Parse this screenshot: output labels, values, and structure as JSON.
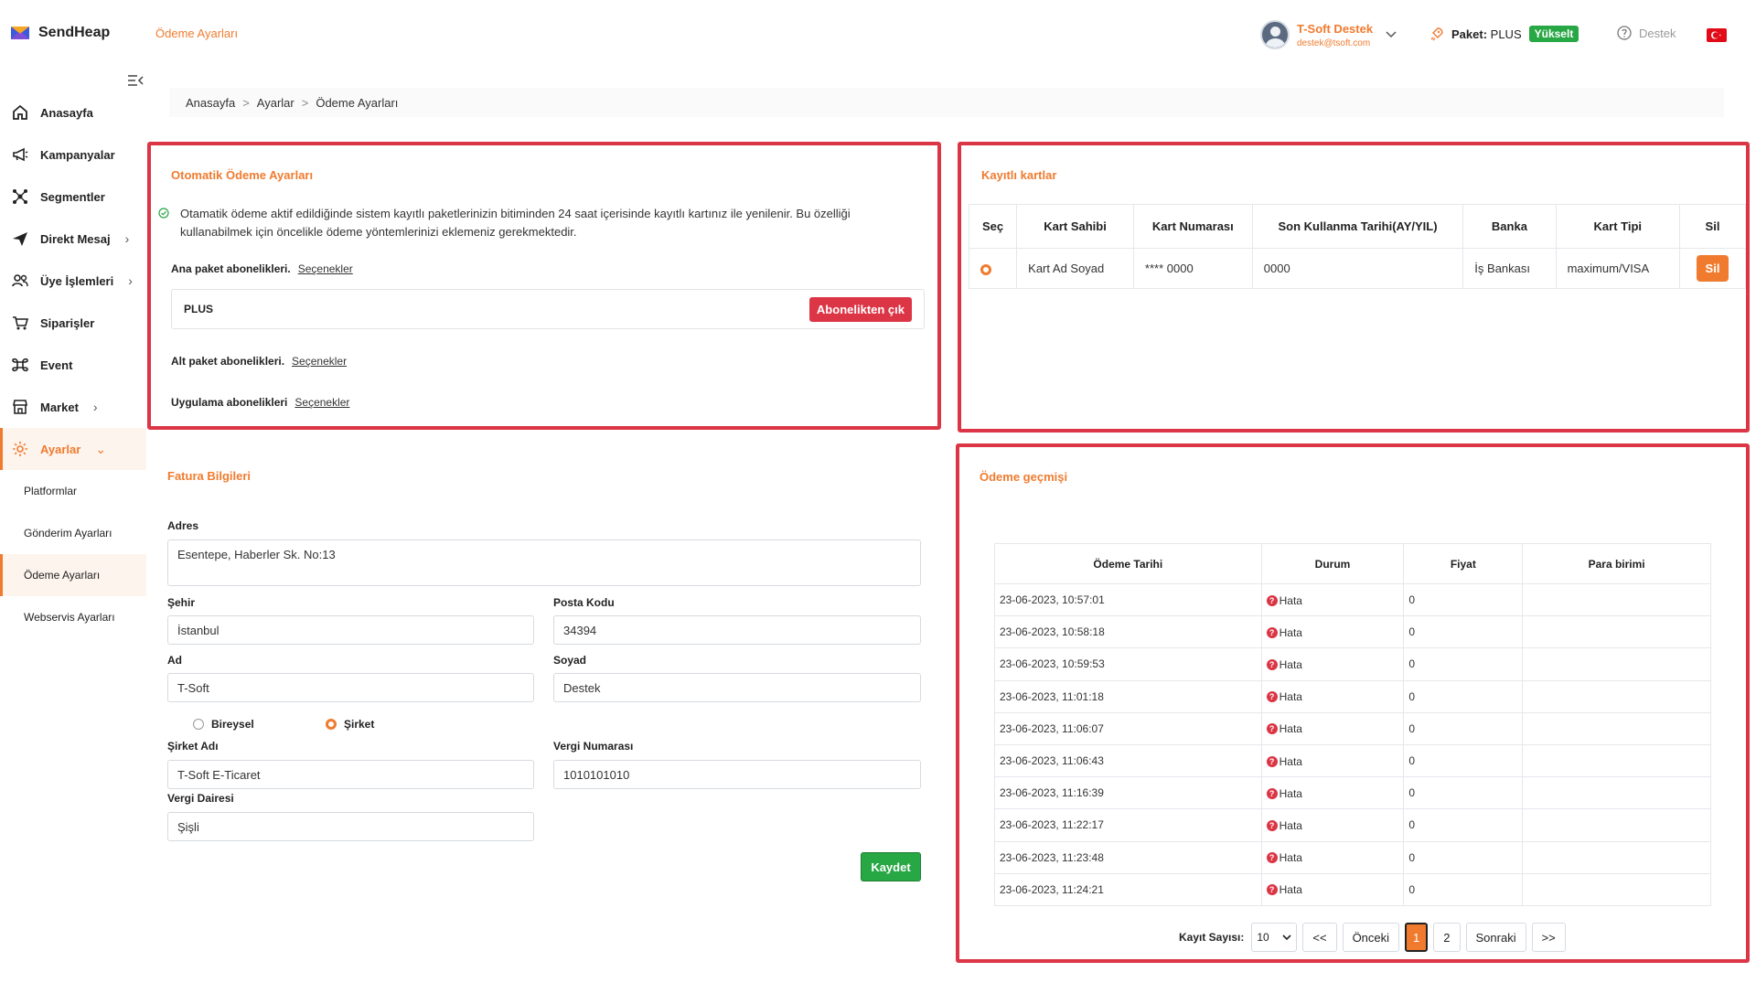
{
  "app": {
    "name": "SendHeap",
    "page_title": "Ödeme Ayarları"
  },
  "header": {
    "user_name": "T-Soft Destek",
    "user_email": "destek@tsoft.com",
    "package_label": "Paket:",
    "package_value": "PLUS",
    "upgrade_label": "Yükselt",
    "support_label": "Destek"
  },
  "sidebar": {
    "items": [
      {
        "label": "Anasayfa"
      },
      {
        "label": "Kampanyalar"
      },
      {
        "label": "Segmentler"
      },
      {
        "label": "Direkt Mesaj"
      },
      {
        "label": "Üye İşlemleri"
      },
      {
        "label": "Siparişler"
      },
      {
        "label": "Event"
      },
      {
        "label": "Market"
      },
      {
        "label": "Ayarlar"
      }
    ],
    "sub_items": [
      {
        "label": "Platformlar"
      },
      {
        "label": "Gönderim Ayarları"
      },
      {
        "label": "Ödeme Ayarları"
      },
      {
        "label": "Webservis Ayarları"
      }
    ]
  },
  "breadcrumb": {
    "home": "Anasayfa",
    "settings": "Ayarlar",
    "current": "Ödeme Ayarları",
    "sep": ">"
  },
  "auto_payment": {
    "title": "Otomatik Ödeme Ayarları",
    "info": "Otamatik ödeme aktif edildiğinde sistem kayıtlı paketlerinizin bitiminden 24 saat içerisinde kayıtlı kartınız ile yenilenir. Bu özelliği kullanabilmek için öncelikle ödeme yöntemlerinizi eklemeniz gerekmektedir.",
    "main_label": "Ana paket abonelikleri.",
    "sub_label": "Alt paket abonelikleri.",
    "app_label": "Uygulama abonelikleri",
    "options_link": "Seçenekler",
    "plan": "PLUS",
    "unsubscribe": "Abonelikten çık"
  },
  "saved_cards": {
    "title": "Kayıtlı kartlar",
    "columns": [
      "Seç",
      "Kart Sahibi",
      "Kart Numarası",
      "Son Kullanma Tarihi(AY/YIL)",
      "Banka",
      "Kart Tipi",
      "Sil"
    ],
    "row": {
      "holder": "Kart Ad Soyad",
      "number": "**** 0000",
      "expiry": "0000",
      "bank": "İş Bankası",
      "type": "maximum/VISA",
      "delete": "Sil"
    }
  },
  "invoice": {
    "title": "Fatura Bilgileri",
    "address_label": "Adres",
    "address": "Esentepe, Haberler Sk. No:13",
    "city_label": "Şehir",
    "city": "İstanbul",
    "postal_label": "Posta Kodu",
    "postal": "34394",
    "name_label": "Ad",
    "name": "T-Soft",
    "surname_label": "Soyad",
    "surname": "Destek",
    "individual": "Bireysel",
    "company": "Şirket",
    "company_name_label": "Şirket Adı",
    "company_name": "T-Soft E-Ticaret",
    "tax_no_label": "Vergi Numarası",
    "tax_no": "1010101010",
    "tax_office_label": "Vergi Dairesi",
    "tax_office": "Şişli",
    "save": "Kaydet"
  },
  "history": {
    "title": "Ödeme geçmişi",
    "columns": [
      "Ödeme Tarihi",
      "Durum",
      "Fiyat",
      "Para birimi"
    ],
    "status": "Hata",
    "rows": [
      {
        "date": "23-06-2023, 10:57:01",
        "price": "0"
      },
      {
        "date": "23-06-2023, 10:58:18",
        "price": "0"
      },
      {
        "date": "23-06-2023, 10:59:53",
        "price": "0"
      },
      {
        "date": "23-06-2023, 11:01:18",
        "price": "0"
      },
      {
        "date": "23-06-2023, 11:06:07",
        "price": "0"
      },
      {
        "date": "23-06-2023, 11:06:43",
        "price": "0"
      },
      {
        "date": "23-06-2023, 11:16:39",
        "price": "0"
      },
      {
        "date": "23-06-2023, 11:22:17",
        "price": "0"
      },
      {
        "date": "23-06-2023, 11:23:48",
        "price": "0"
      },
      {
        "date": "23-06-2023, 11:24:21",
        "price": "0"
      }
    ],
    "pager": {
      "count_label": "Kayıt Sayısı:",
      "count": "10",
      "first": "<<",
      "prev": "Önceki",
      "page1": "1",
      "page2": "2",
      "next": "Sonraki",
      "last": ">>"
    }
  },
  "colors": {
    "accent": "#f07b2f",
    "danger": "#dc3545",
    "success": "#28a745"
  }
}
